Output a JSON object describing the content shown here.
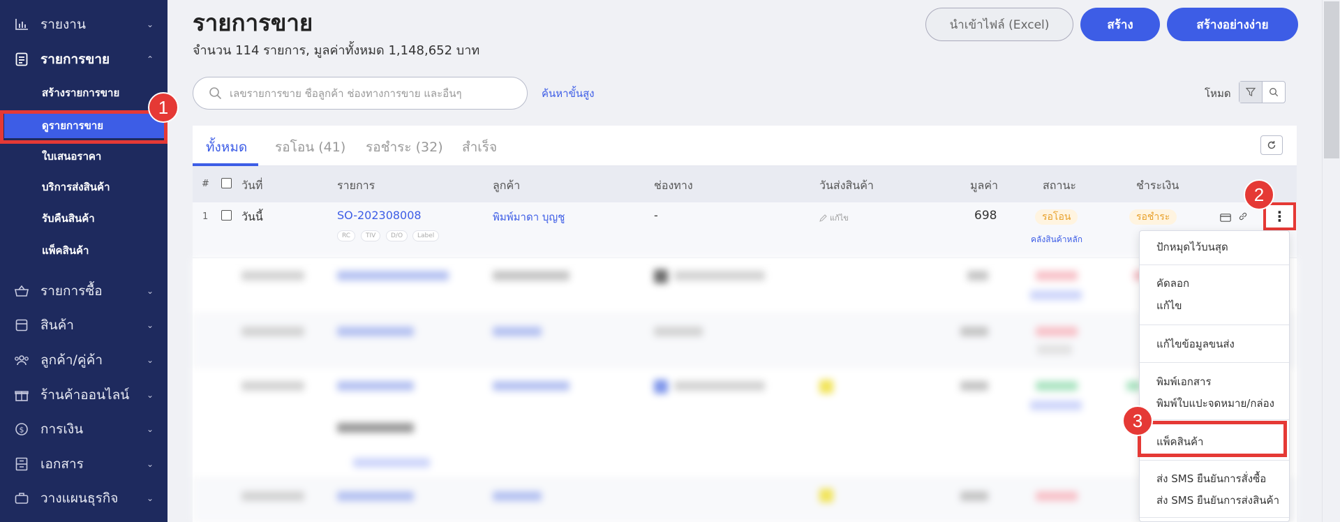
{
  "sidebar": {
    "items_top": [
      {
        "label": "รายงาน",
        "icon": "bar-chart-icon"
      },
      {
        "label": "รายการขาย",
        "icon": "document-list-icon"
      }
    ],
    "sales_sub": [
      {
        "label": "สร้างรายการขาย"
      },
      {
        "label": "ดูรายการขาย"
      },
      {
        "label": "ใบเสนอราคา"
      },
      {
        "label": "บริการส่งสินค้า"
      },
      {
        "label": "รับคืนสินค้า"
      },
      {
        "label": "แพ็คสินค้า"
      }
    ],
    "items_bottom": [
      {
        "label": "รายการซื้อ",
        "icon": "basket-icon"
      },
      {
        "label": "สินค้า",
        "icon": "box-icon"
      },
      {
        "label": "ลูกค้า/คู่ค้า",
        "icon": "users-icon"
      },
      {
        "label": "ร้านค้าออนไลน์",
        "icon": "gift-icon"
      },
      {
        "label": "การเงิน",
        "icon": "dollar-circle-icon"
      },
      {
        "label": "เอกสาร",
        "icon": "archive-icon"
      },
      {
        "label": "วางแผนธุรกิจ",
        "icon": "briefcase-icon"
      }
    ]
  },
  "annotations": {
    "step1": "1",
    "step2": "2",
    "step3": "3"
  },
  "header": {
    "title": "รายการขาย",
    "subtitle": "จำนวน 114 รายการ, มูลค่าทั้งหมด 1,148,652 บาท",
    "import_label": "นำเข้าไฟล์ (Excel)",
    "create_label": "สร้าง",
    "simple_create_label": "สร้างอย่างง่าย"
  },
  "search": {
    "placeholder": "เลขรายการขาย ชื่อลูกค้า ช่องทางการขาย และอื่นๆ",
    "advanced_label": "ค้นหาขั้นสูง",
    "mode_label": "โหมด"
  },
  "tabs": [
    {
      "label": "ทั้งหมด"
    },
    {
      "label": "รอโอน (41)"
    },
    {
      "label": "รอชำระ (32)"
    },
    {
      "label": "สำเร็จ"
    }
  ],
  "table": {
    "headers": {
      "num": "#",
      "date": "วันที่",
      "order": "รายการ",
      "customer": "ลูกค้า",
      "channel": "ช่องทาง",
      "ship_date": "วันส่งสินค้า",
      "amount": "มูลค่า",
      "status": "สถานะ",
      "payment": "ชำระเงิน"
    },
    "row1": {
      "num": "1",
      "date": "วันนี้",
      "order": "SO-202308008",
      "tags": [
        "RC",
        "TIV",
        "D/O",
        "Label"
      ],
      "customer": "พิมพ์มาดา บุญชู",
      "channel": "-",
      "ship_edit": "แก้ไข",
      "amount": "698",
      "status": "รอโอน",
      "warehouse": "คลังสินค้าหลัก",
      "payment": "รอชำระ"
    }
  },
  "menu": {
    "pin": "ปักหมุดไว้บนสุด",
    "copy": "คัดลอก",
    "edit": "แก้ไข",
    "edit_shipping": "แก้ไขข้อมูลขนส่ง",
    "print_doc": "พิมพ์เอกสาร",
    "print_label": "พิมพ์ใบแปะจดหมาย/กล่อง",
    "pack": "แพ็คสินค้า",
    "sms_order": "ส่ง SMS ยืนยันการสั่งซื้อ",
    "sms_ship": "ส่ง SMS ยืนยันการส่งสินค้า"
  },
  "colors": {
    "sidebar_bg": "#1e2a5e",
    "primary": "#3d5de6",
    "highlight": "#e53935",
    "status_pending": "#e8a02a"
  }
}
